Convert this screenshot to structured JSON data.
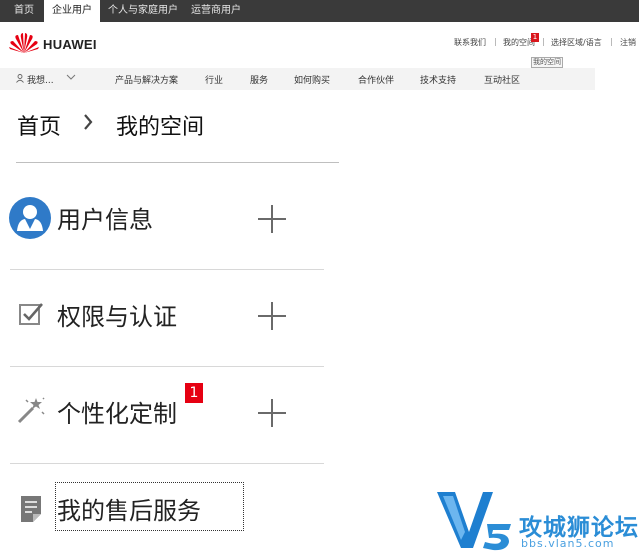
{
  "topbar": {
    "tabs": [
      {
        "label": "首页",
        "active": false
      },
      {
        "label": "企业用户",
        "active": true
      },
      {
        "label": "个人与家庭用户",
        "active": false
      },
      {
        "label": "运营商用户",
        "active": false
      }
    ]
  },
  "header": {
    "brand": "HUAWEI",
    "links": {
      "contact": "联系我们",
      "myspace": "我的空间",
      "region": "选择区域/语言",
      "logout": "注销"
    },
    "notification_count": "1",
    "tooltip": "我的空间"
  },
  "nav": {
    "user_label": "我想...",
    "items": [
      "产品与解决方案",
      "行业",
      "服务",
      "如何购买",
      "合作伙伴",
      "技术支持",
      "互动社区"
    ]
  },
  "breadcrumb": {
    "home": "首页",
    "current": "我的空间"
  },
  "menu": {
    "items": [
      {
        "label": "用户信息",
        "icon": "user-profile-icon"
      },
      {
        "label": "权限与认证",
        "icon": "checkbox-icon"
      },
      {
        "label": "个性化定制",
        "icon": "magic-wand-icon",
        "badge": "1"
      },
      {
        "label": "我的售后服务",
        "icon": "document-icon"
      }
    ]
  },
  "watermark": {
    "title": "攻城狮论坛",
    "url": "bbs.vlan5.com"
  },
  "colors": {
    "topbar": "#3a3a3a",
    "huawei_red": "#e60012",
    "badge": "#e60012",
    "watermark_blue": "#2b8dd6"
  }
}
